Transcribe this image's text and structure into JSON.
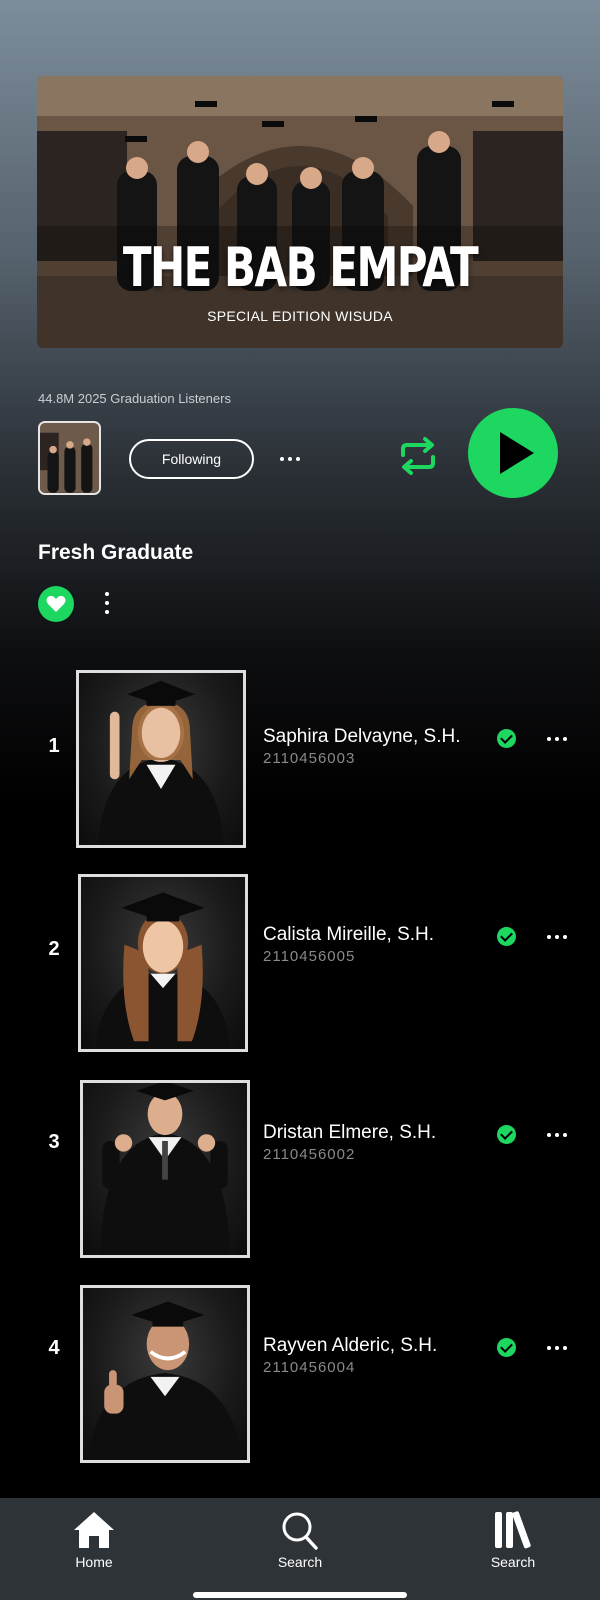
{
  "hero": {
    "title": "THE BAB EMPAT",
    "subtitle": "SPECIAL EDITION WISUDA"
  },
  "artist": {
    "listeners": "44.8M 2025 Graduation Listeners",
    "follow_label": "Following"
  },
  "colors": {
    "accent": "#1ed760",
    "nav_background": "#2e3338"
  },
  "section": {
    "title": "Fresh Graduate"
  },
  "tracks": [
    {
      "number": "1",
      "name": "Saphira Delvayne, S.H.",
      "id": "2110456003",
      "verified": true
    },
    {
      "number": "2",
      "name": "Calista Mireille, S.H.",
      "id": "2110456005",
      "verified": true
    },
    {
      "number": "3",
      "name": "Dristan Elmere, S.H.",
      "id": "2110456002",
      "verified": true
    },
    {
      "number": "4",
      "name": "Rayven Alderic, S.H.",
      "id": "2110456004",
      "verified": true
    }
  ],
  "nav": {
    "items": [
      {
        "label": "Home",
        "icon": "home-icon"
      },
      {
        "label": "Search",
        "icon": "search-icon"
      },
      {
        "label": "Search",
        "icon": "library-icon"
      }
    ]
  }
}
